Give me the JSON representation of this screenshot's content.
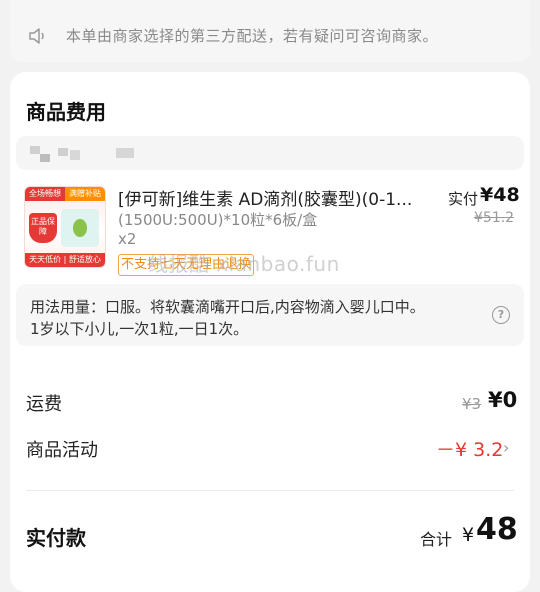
{
  "notice": {
    "icon": "speaker-icon",
    "text": "本单由商家选择的第三方配送，若有疑问可咨询商家。"
  },
  "goods": {
    "title": "商品费用",
    "product": {
      "name": "[伊可新]维生素 AD滴剂(胶囊型)(0-1...",
      "spec": "(1500U:500U)*10粒*6板/盒",
      "qty": "x2",
      "price_label": "实付",
      "price": "¥48",
      "original_price": "¥51.2",
      "tag": "不支持七天无理由退换",
      "thumb": {
        "badge_left": "全场畅想",
        "badge_right": "满赠补贴",
        "shield": "正品保障",
        "footer": "天天低价 | 舒适放心"
      }
    },
    "watermark": "线报酷 xianbao.fun",
    "usage": {
      "line1": "用法用量：口服。将软囊滴嘴开口后,内容物滴入婴儿口中。",
      "line2": "1岁以下小儿,一次1粒,一日1次。",
      "help_icon": "?"
    }
  },
  "fees": {
    "shipping_label": "运费",
    "shipping_original": "¥3",
    "shipping_value": "¥0",
    "promo_label": "商品活动",
    "promo_value": "－¥ 3.2",
    "chevron": "›"
  },
  "total": {
    "label": "实付款",
    "sum_label": "合计",
    "currency": "¥",
    "value": "48"
  },
  "colors": {
    "accent_red": "#e5382e",
    "tag_orange": "#f08c10"
  }
}
